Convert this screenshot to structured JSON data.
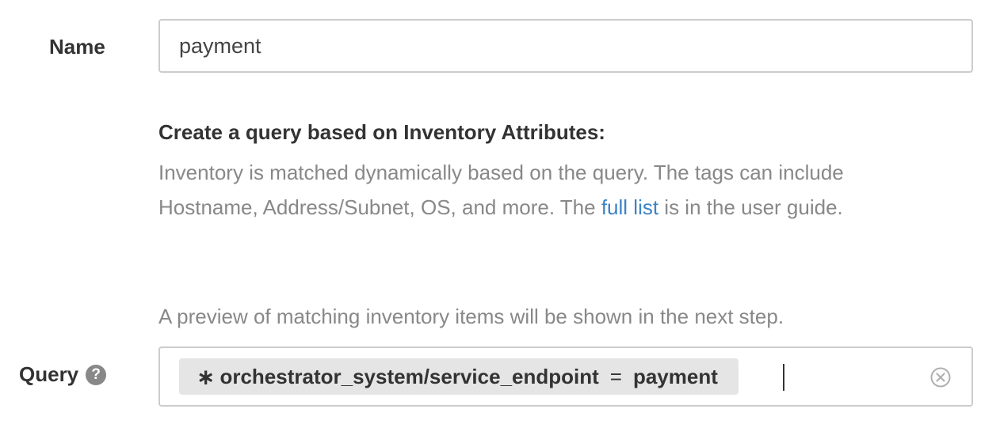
{
  "name_field": {
    "label": "Name",
    "value": "payment"
  },
  "help": {
    "heading": "Create a query based on Inventory Attributes:",
    "text_before_link": "Inventory is matched dynamically based on the query. The tags can include Hostname, Address/Subnet, OS, and more. The ",
    "link_text": "full list",
    "text_after_link": " is in the user guide.",
    "preview_note": "A preview of matching inventory items will be shown in the next step."
  },
  "query_field": {
    "label": "Query",
    "help_icon_glyph": "?",
    "chip": {
      "star": "∗",
      "key": "orchestrator_system/service_endpoint",
      "operator": "=",
      "value": "payment"
    }
  },
  "colors": {
    "link": "#3c82c4",
    "muted_text": "#888888",
    "chip_background": "#e5e5e5",
    "border": "#cccccc"
  },
  "icons": {
    "help": "question-circle-icon",
    "clear": "clear-circle-x-icon"
  }
}
